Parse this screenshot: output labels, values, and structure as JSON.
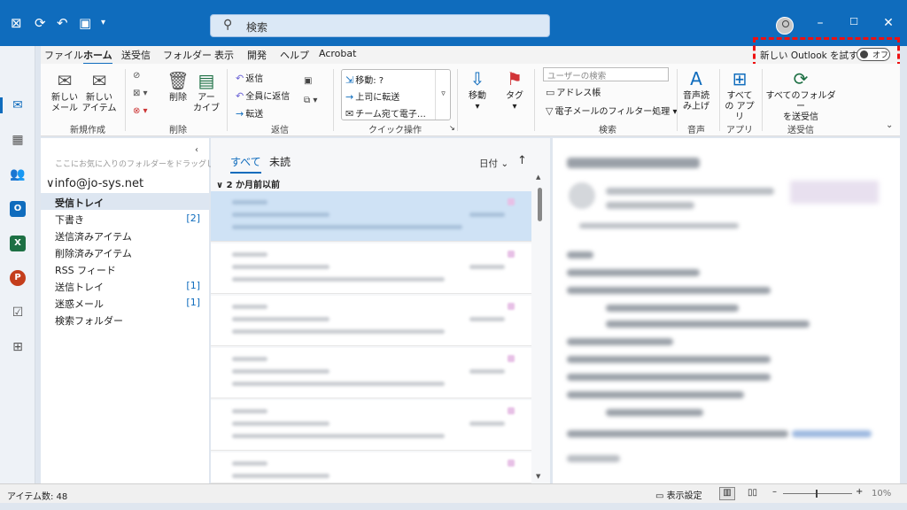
{
  "search": {
    "placeholder": "検索"
  },
  "menu": {
    "items": [
      "ファイル",
      "ホーム",
      "送受信",
      "フォルダー",
      "表示",
      "開発",
      "ヘルプ",
      "Acrobat"
    ],
    "active": "ホーム",
    "try_new_outlook": "新しい Outlook を試す",
    "toggle_label": "オフ"
  },
  "ribbon": {
    "new_mail": "新しい\nメール",
    "new_items": "新しい\nアイテム",
    "delete": "削除",
    "archive": "アー\nカイブ",
    "reply": "返信",
    "reply_all": "全員に返信",
    "forward": "転送",
    "qs_move": "移動: ?",
    "qs_to_manager": "上司に転送",
    "qs_team_email": "チーム宛て電子…",
    "move": "移動",
    "tags": "タグ",
    "search_people_placeholder": "ユーザーの検索",
    "address_book": "アドレス帳",
    "filter_email": "電子メールのフィルター処理",
    "read_aloud": "音声読\nみ上げ",
    "all_apps": "すべて\nの アプリ",
    "send_receive_all": "すべてのフォルダー\nを送受信",
    "groups": {
      "new": "新規作成",
      "delete": "削除",
      "respond": "返信",
      "quick_steps": "クイック操作",
      "find": "検索",
      "speech": "音声",
      "apps": "アプリ",
      "send_receive": "送受信"
    }
  },
  "folders": {
    "favorites_hint": "ここにお気に入りのフォルダーをドラッグします",
    "account": "info@jo-sys.net",
    "items": [
      {
        "name": "受信トレイ",
        "count": ""
      },
      {
        "name": "下書き",
        "count": "[2]"
      },
      {
        "name": "送信済みアイテム",
        "count": ""
      },
      {
        "name": "削除済みアイテム",
        "count": ""
      },
      {
        "name": "RSS フィード",
        "count": ""
      },
      {
        "name": "送信トレイ",
        "count": "[1]"
      },
      {
        "name": "迷惑メール",
        "count": "[1]"
      },
      {
        "name": "検索フォルダー",
        "count": ""
      }
    ]
  },
  "messages": {
    "tab_all": "すべて",
    "tab_unread": "未読",
    "sort_label": "日付",
    "group_header": "2 か月前以前"
  },
  "status": {
    "item_count": "アイテム数: 48",
    "view_settings": "表示設定",
    "zoom": "10%"
  },
  "colors": {
    "accent": "#0f6cbd",
    "highlight_box": "#e11111"
  }
}
